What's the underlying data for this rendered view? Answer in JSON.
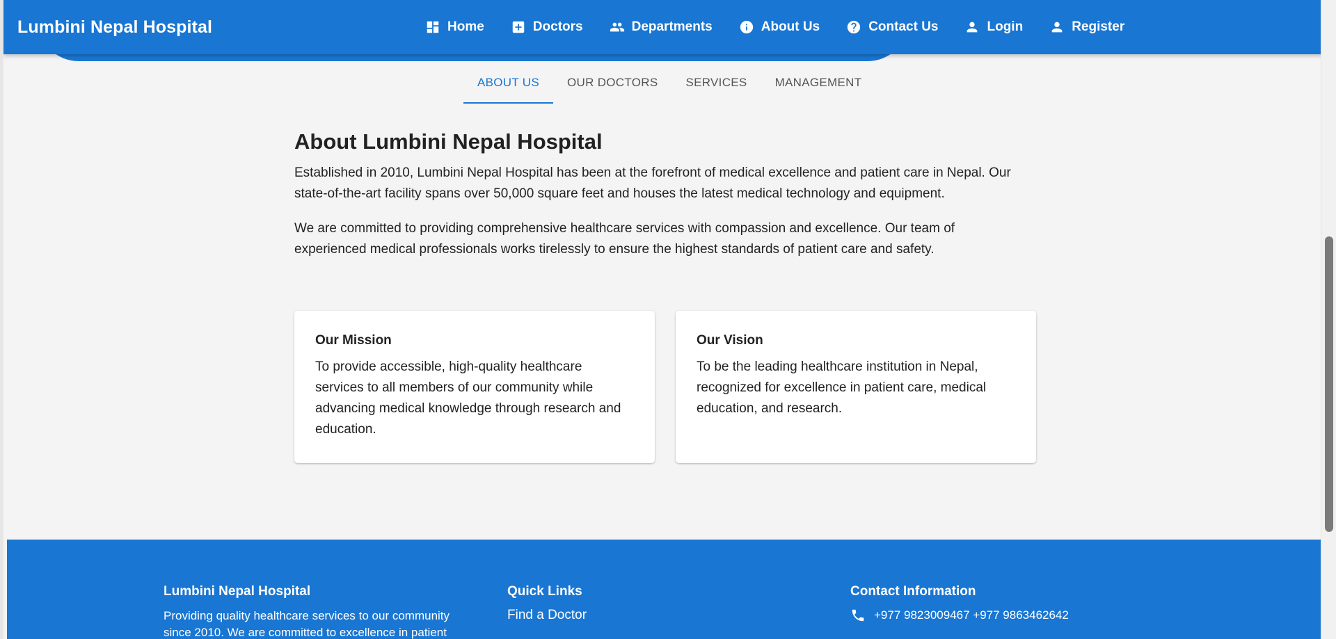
{
  "header": {
    "brand": "Lumbini Nepal Hospital",
    "nav": [
      {
        "label": "Home",
        "icon": "dashboard-icon"
      },
      {
        "label": "Doctors",
        "icon": "medical-plus-icon"
      },
      {
        "label": "Departments",
        "icon": "people-icon"
      },
      {
        "label": "About Us",
        "icon": "info-icon"
      },
      {
        "label": "Contact Us",
        "icon": "help-icon"
      },
      {
        "label": "Login",
        "icon": "person-icon"
      },
      {
        "label": "Register",
        "icon": "person-icon"
      }
    ]
  },
  "tabs": [
    {
      "label": "ABOUT US",
      "active": true
    },
    {
      "label": "OUR DOCTORS",
      "active": false
    },
    {
      "label": "SERVICES",
      "active": false
    },
    {
      "label": "MANAGEMENT",
      "active": false
    }
  ],
  "about": {
    "title": "About Lumbini Nepal Hospital",
    "paragraphs": [
      "Established in 2010, Lumbini Nepal Hospital has been at the forefront of medical excellence and patient care in Nepal. Our state-of-the-art facility spans over 50,000 square feet and houses the latest medical technology and equipment.",
      "We are committed to providing comprehensive healthcare services with compassion and excellence. Our team of experienced medical professionals works tirelessly to ensure the highest standards of patient care and safety."
    ],
    "cards": [
      {
        "title": "Our Mission",
        "text": "To provide accessible, high-quality healthcare services to all members of our community while advancing medical knowledge through research and education."
      },
      {
        "title": "Our Vision",
        "text": "To be the leading healthcare institution in Nepal, recognized for excellence in patient care, medical education, and research."
      }
    ]
  },
  "footer": {
    "about_title": "Lumbini Nepal Hospital",
    "about_text": "Providing quality healthcare services to our community since 2010. We are committed to excellence in patient",
    "links_title": "Quick Links",
    "links": [
      "Find a Doctor"
    ],
    "contact_title": "Contact Information",
    "phone": "+977 9823009467 +977 9863462642"
  },
  "colors": {
    "primary": "#1976d2",
    "background": "#f4f4f4"
  }
}
